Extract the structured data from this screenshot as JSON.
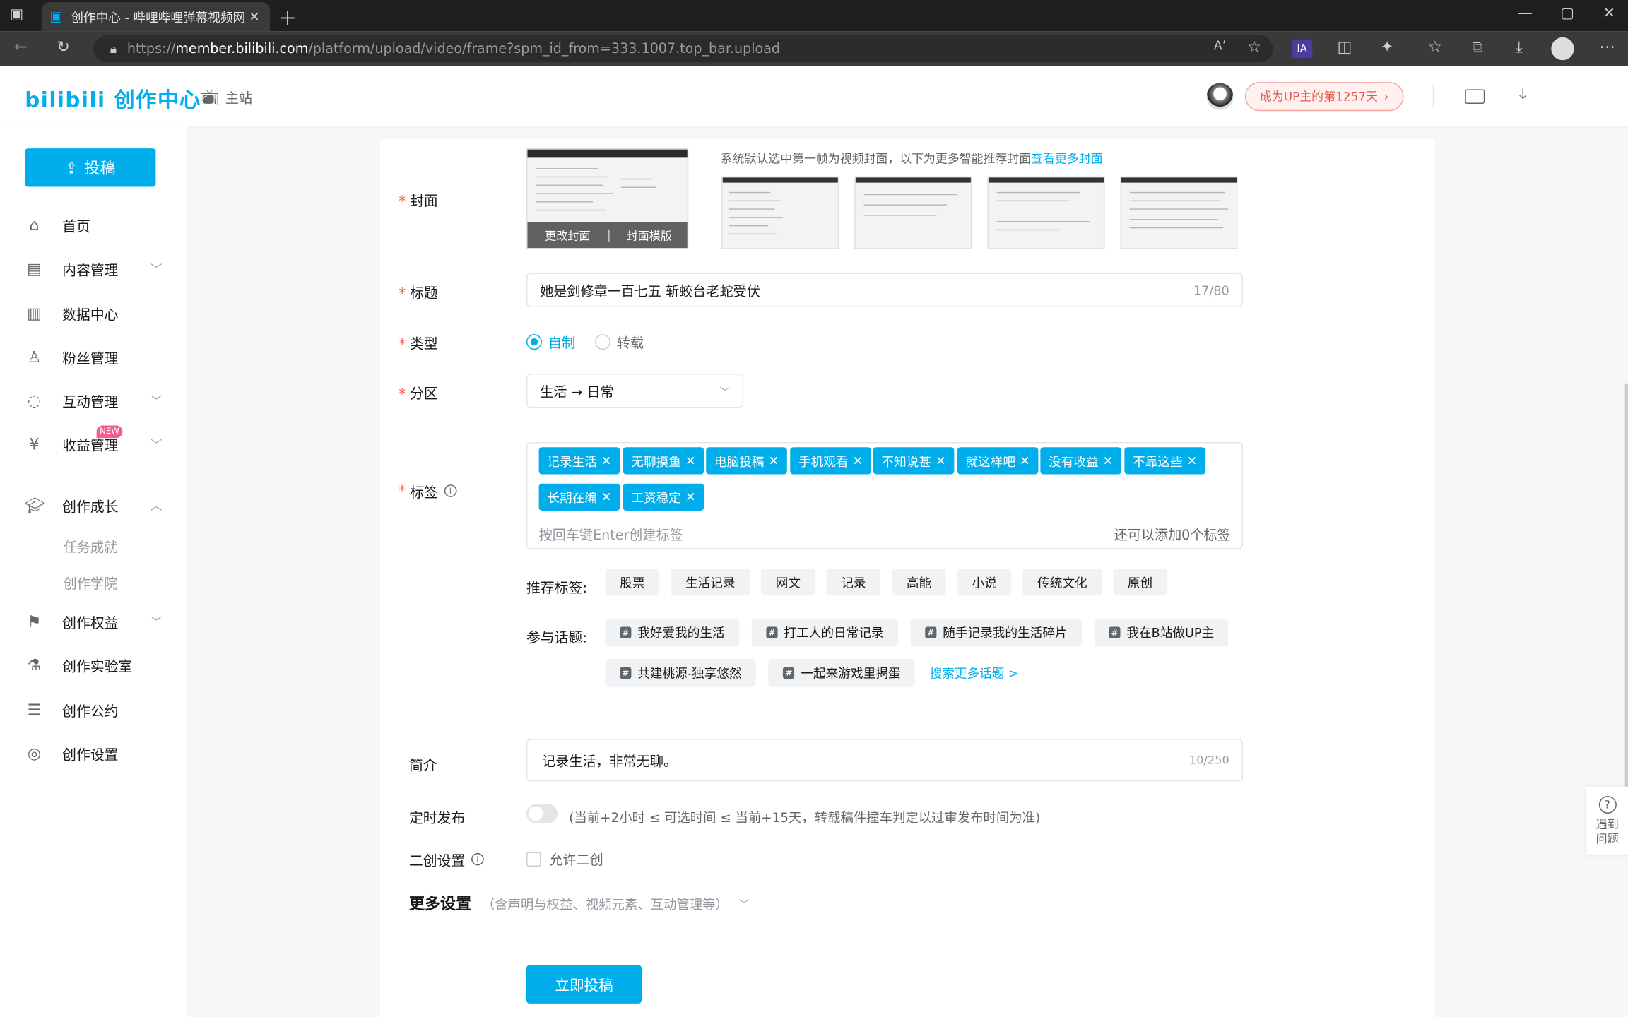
{
  "browser": {
    "tab_title": "创作中心 - 哔哩哔哩弹幕视频网",
    "url_prefix": "https://",
    "url_domain": "member.bilibili.com",
    "url_path": "/platform/upload/video/frame?spm_id_from=333.1007.top_bar.upload",
    "profile_label": "IA"
  },
  "header": {
    "logo": "bilibili 创作中心",
    "main_site": "主站",
    "up_days_badge": "成为UP主的第1257天"
  },
  "sidebar": {
    "post_button": "投稿",
    "new_badge": "NEW",
    "items": [
      {
        "label": "首页"
      },
      {
        "label": "内容管理"
      },
      {
        "label": "数据中心"
      },
      {
        "label": "粉丝管理"
      },
      {
        "label": "互动管理"
      },
      {
        "label": "收益管理"
      },
      {
        "label": "创作成长"
      },
      {
        "label": "任务成就"
      },
      {
        "label": "创作学院"
      },
      {
        "label": "创作权益"
      },
      {
        "label": "创作实验室"
      },
      {
        "label": "创作公约"
      },
      {
        "label": "创作设置"
      }
    ]
  },
  "form": {
    "cover": {
      "label": "封面",
      "hint": "系统默认选中第一帧为视频封面，以下为更多智能推荐封面",
      "hint_link": "查看更多封面",
      "change_cover": "更改封面",
      "cover_template": "封面模版"
    },
    "title": {
      "label": "标题",
      "value": "她是剑修章一百七五 斩蛟台老蛇受伏",
      "counter": "17/80"
    },
    "type": {
      "label": "类型",
      "options": [
        "自制",
        "转载"
      ],
      "selected": "自制"
    },
    "category": {
      "label": "分区",
      "value": "生活 → 日常"
    },
    "tags": {
      "label": "标签",
      "items": [
        "记录生活",
        "无聊摸鱼",
        "电脑投稿",
        "手机观看",
        "不知说甚",
        "就这样吧",
        "没有收益",
        "不靠这些",
        "长期在编",
        "工资稳定"
      ],
      "placeholder": "按回车键Enter创建标签",
      "remaining": "还可以添加0个标签"
    },
    "recommended": {
      "label": "推荐标签:",
      "items": [
        "股票",
        "生活记录",
        "网文",
        "记录",
        "高能",
        "小说",
        "传统文化",
        "原创"
      ]
    },
    "topics": {
      "label": "参与话题:",
      "items": [
        "我好爱我的生活",
        "打工人的日常记录",
        "随手记录我的生活碎片",
        "我在B站做UP主",
        "共建桃源-独享悠然",
        "一起来游戏里揭蛋"
      ],
      "more": "搜索更多话题 >"
    },
    "intro": {
      "label": "简介",
      "value": "记录生活，非常无聊。",
      "counter": "10/250"
    },
    "schedule": {
      "label": "定时发布",
      "note": "(当前+2小时 ≤ 可选时间 ≤ 当前+15天，转载稿件撞车判定以过审发布时间为准)"
    },
    "remix": {
      "label": "二创设置",
      "checkbox": "允许二创"
    },
    "more": {
      "title": "更多设置",
      "desc": "（含声明与权益、视频元素、互动管理等）"
    },
    "submit": "立即投稿"
  },
  "help": {
    "label1": "遇到",
    "label2": "问题"
  },
  "colors": {
    "accent": "#00aeec",
    "required": "#f85a54",
    "badge_text": "#e05a4f"
  }
}
